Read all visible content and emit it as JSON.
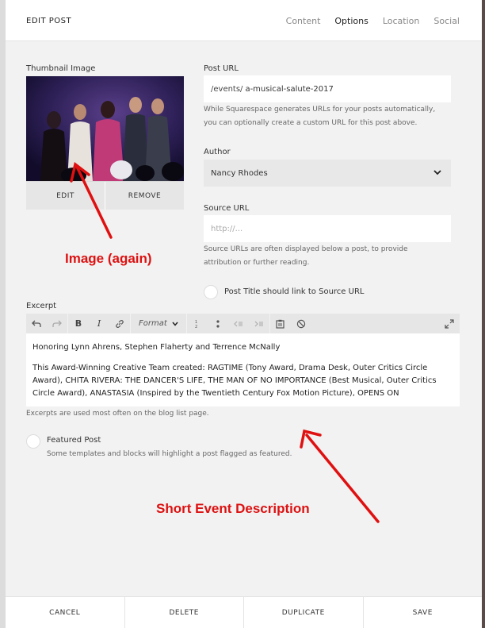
{
  "header": {
    "title": "EDIT POST",
    "tabs": [
      {
        "label": "Content",
        "active": false
      },
      {
        "label": "Options",
        "active": true
      },
      {
        "label": "Location",
        "active": false
      },
      {
        "label": "Social",
        "active": false
      }
    ]
  },
  "thumbnail": {
    "label": "Thumbnail Image",
    "edit_label": "EDIT",
    "remove_label": "REMOVE"
  },
  "post_url": {
    "label": "Post URL",
    "prefix": "/events/",
    "value": "a-musical-salute-2017",
    "help_line1": "While Squarespace generates URLs for your posts automatically,",
    "help_line2": "you can optionally create a custom URL for this post above."
  },
  "author": {
    "label": "Author",
    "value": "Nancy Rhodes",
    "icon": "chevron-down-icon"
  },
  "source_url": {
    "label": "Source URL",
    "placeholder": "http://...",
    "help_line1": "Source URLs are often displayed below a post, to provide",
    "help_line2": "attribution or further reading."
  },
  "link_checkbox": {
    "label": "Post Title should link to Source URL",
    "checked": false
  },
  "excerpt": {
    "label": "Excerpt",
    "format_label": "Format",
    "para1": "Honoring Lynn Ahrens, Stephen Flaherty and Terrence McNally",
    "para2": "This Award-Winning Creative Team created: RAGTIME (Tony Award, Drama Desk, Outer Critics Circle Award), CHITA RIVERA: THE DANCER'S LIFE, THE MAN OF NO IMPORTANCE (Best Musical, Outer Critics Circle Award), ANASTASIA (Inspired by the Twentieth Century Fox Motion Picture), OPENS ON",
    "help": "Excerpts are used most often on the blog list page."
  },
  "featured": {
    "label": "Featured Post",
    "help": "Some templates and blocks will highlight a post flagged as featured.",
    "checked": false
  },
  "footer": {
    "cancel": "CANCEL",
    "delete": "DELETE",
    "duplicate": "DUPLICATE",
    "save": "SAVE"
  },
  "annotations": {
    "image": "Image (again)",
    "description": "Short Event Description",
    "color": "#dd1111"
  }
}
